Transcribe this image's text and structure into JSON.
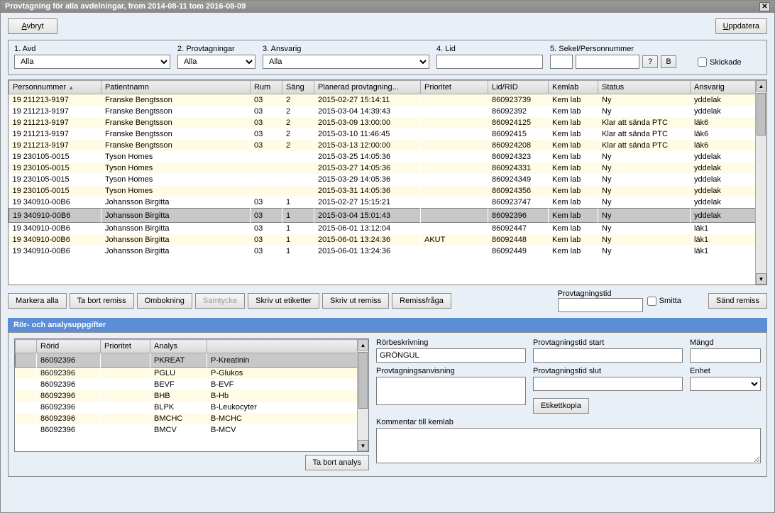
{
  "window": {
    "title": "Provtagning för alla avdelningar, from 2014-08-11  tom 2016-08-09"
  },
  "buttons": {
    "cancel": "Avbryt",
    "cancel_accel": "A",
    "update": "Uppdatera",
    "update_accel": "U",
    "markAll": "Markera alla",
    "removeReferral": "Ta bort remiss",
    "rebooking": "Ombokning",
    "consent": "Samtycke",
    "printLabels": "Skriv ut etiketter",
    "printReferral": "Skriv ut remiss",
    "referralQuestion": "Remissfråga",
    "sendReferral": "Sänd remiss",
    "labelCopy": "Etikettkopia",
    "removeAnalysis": "Ta bort analys",
    "question": "?",
    "b": "B"
  },
  "filters": {
    "avd": {
      "label": "1. Avd",
      "value": "Alla"
    },
    "provtagningar": {
      "label": "2. Provtagningar",
      "value": "Alla"
    },
    "ansvarig": {
      "label": "3. Ansvarig",
      "value": "Alla"
    },
    "lid": {
      "label": "4. Lid",
      "value": ""
    },
    "sekel": {
      "label": "5. Sekel/Personnummer",
      "value1": "",
      "value2": ""
    },
    "skickade": "Skickade"
  },
  "mainTable": {
    "headers": {
      "personnummer": "Personnummer",
      "patientnamn": "Patientnamn",
      "rum": "Rum",
      "sang": "Säng",
      "planerad": "Planerad provtagning...",
      "prioritet": "Prioritet",
      "lidrid": "Lid/RID",
      "kemlab": "Kemlab",
      "status": "Status",
      "ansvarig": "Ansvarig"
    },
    "rows": [
      {
        "pn": "19 211213-9197",
        "namn": "Franske Bengtsson",
        "rum": "03",
        "sang": "2",
        "plan": "2015-02-27 15:14:11",
        "prio": "",
        "lid": "860923739",
        "kem": "Kem lab",
        "status": "Ny",
        "ansv": "yddelak",
        "alt": true
      },
      {
        "pn": "19 211213-9197",
        "namn": "Franske Bengtsson",
        "rum": "03",
        "sang": "2",
        "plan": "2015-03-04 14:39:43",
        "prio": "",
        "lid": "86092392",
        "kem": "Kem lab",
        "status": "Ny",
        "ansv": "yddelak",
        "alt": false
      },
      {
        "pn": "19 211213-9197",
        "namn": "Franske Bengtsson",
        "rum": "03",
        "sang": "2",
        "plan": "2015-03-09 13:00:00",
        "prio": "",
        "lid": "860924125",
        "kem": "Kem lab",
        "status": "Klar att sända PTC",
        "ansv": "läk6",
        "alt": true
      },
      {
        "pn": "19 211213-9197",
        "namn": "Franske Bengtsson",
        "rum": "03",
        "sang": "2",
        "plan": "2015-03-10 11:46:45",
        "prio": "",
        "lid": "86092415",
        "kem": "Kem lab",
        "status": "Klar att sända PTC",
        "ansv": "läk6",
        "alt": false
      },
      {
        "pn": "19 211213-9197",
        "namn": "Franske Bengtsson",
        "rum": "03",
        "sang": "2",
        "plan": "2015-03-13 12:00:00",
        "prio": "",
        "lid": "860924208",
        "kem": "Kem lab",
        "status": "Klar att sända PTC",
        "ansv": "läk6",
        "alt": true
      },
      {
        "pn": "19 230105-0015",
        "namn": "Tyson Homes",
        "rum": "",
        "sang": "",
        "plan": "2015-03-25 14:05:36",
        "prio": "",
        "lid": "860924323",
        "kem": "Kem lab",
        "status": "Ny",
        "ansv": "yddelak",
        "alt": false
      },
      {
        "pn": "19 230105-0015",
        "namn": "Tyson Homes",
        "rum": "",
        "sang": "",
        "plan": "2015-03-27 14:05:36",
        "prio": "",
        "lid": "860924331",
        "kem": "Kem lab",
        "status": "Ny",
        "ansv": "yddelak",
        "alt": true
      },
      {
        "pn": "19 230105-0015",
        "namn": "Tyson Homes",
        "rum": "",
        "sang": "",
        "plan": "2015-03-29 14:05:36",
        "prio": "",
        "lid": "860924349",
        "kem": "Kem lab",
        "status": "Ny",
        "ansv": "yddelak",
        "alt": false
      },
      {
        "pn": "19 230105-0015",
        "namn": "Tyson Homes",
        "rum": "",
        "sang": "",
        "plan": "2015-03-31 14:05:36",
        "prio": "",
        "lid": "860924356",
        "kem": "Kem lab",
        "status": "Ny",
        "ansv": "yddelak",
        "alt": true
      },
      {
        "pn": "19 340910-00B6",
        "namn": "Johansson Birgitta",
        "rum": "03",
        "sang": "1",
        "plan": "2015-02-27 15:15:21",
        "prio": "",
        "lid": "860923747",
        "kem": "Kem lab",
        "status": "Ny",
        "ansv": "yddelak",
        "alt": false
      },
      {
        "pn": "19 340910-00B6",
        "namn": "Johansson Birgitta",
        "rum": "03",
        "sang": "1",
        "plan": "2015-03-04 15:01:43",
        "prio": "",
        "lid": "86092396",
        "kem": "Kem lab",
        "status": "Ny",
        "ansv": "yddelak",
        "sel": true
      },
      {
        "pn": "19 340910-00B6",
        "namn": "Johansson Birgitta",
        "rum": "03",
        "sang": "1",
        "plan": "2015-06-01 13:12:04",
        "prio": "",
        "lid": "86092447",
        "kem": "Kem lab",
        "status": "Ny",
        "ansv": "läk1",
        "alt": false
      },
      {
        "pn": "19 340910-00B6",
        "namn": "Johansson Birgitta",
        "rum": "03",
        "sang": "1",
        "plan": "2015-06-01 13:24:36",
        "prio": "AKUT",
        "lid": "86092448",
        "kem": "Kem lab",
        "status": "Ny",
        "ansv": "läk1",
        "alt": true
      },
      {
        "pn": "19 340910-00B6",
        "namn": "Johansson Birgitta",
        "rum": "03",
        "sang": "1",
        "plan": "2015-06-01 13:24:36",
        "prio": "",
        "lid": "86092449",
        "kem": "Kem lab",
        "status": "Ny",
        "ansv": "läk1",
        "alt": false
      }
    ]
  },
  "mid": {
    "provtagningstid": "Provtagningstid",
    "smitta": "Smitta"
  },
  "panel": {
    "title": "Rör- och analysuppgifter",
    "headers": {
      "rorid": "Rörid",
      "prioritet": "Prioritet",
      "analys": "Analys",
      "blank": ""
    },
    "rows": [
      {
        "rorid": "86092396",
        "prio": "",
        "analys": "PKREAT",
        "desc": "P-Kreatinin",
        "sel": true
      },
      {
        "rorid": "86092396",
        "prio": "",
        "analys": "PGLU",
        "desc": "P-Glukos",
        "alt": true
      },
      {
        "rorid": "86092396",
        "prio": "",
        "analys": "BEVF",
        "desc": "B-EVF"
      },
      {
        "rorid": "86092396",
        "prio": "",
        "analys": "BHB",
        "desc": "B-Hb",
        "alt": true
      },
      {
        "rorid": "86092396",
        "prio": "",
        "analys": "BLPK",
        "desc": "B-Leukocyter"
      },
      {
        "rorid": "86092396",
        "prio": "",
        "analys": "BMCHC",
        "desc": "B-MCHC",
        "alt": true
      },
      {
        "rorid": "86092396",
        "prio": "",
        "analys": "BMCV",
        "desc": "B-MCV"
      }
    ],
    "fields": {
      "rorbeskrivning": {
        "label": "Rörbeskrivning",
        "value": "GRÖNGUL"
      },
      "provtagningsanvisning": {
        "label": "Provtagningsanvisning",
        "value": ""
      },
      "provtagningstidStart": {
        "label": "Provtagningstid start",
        "value": ""
      },
      "provtagningstidSlut": {
        "label": "Provtagningstid slut",
        "value": ""
      },
      "mangd": {
        "label": "Mängd",
        "value": ""
      },
      "enhet": {
        "label": "Enhet",
        "value": ""
      },
      "kommentar": {
        "label": "Kommentar till kemlab",
        "value": ""
      }
    }
  }
}
